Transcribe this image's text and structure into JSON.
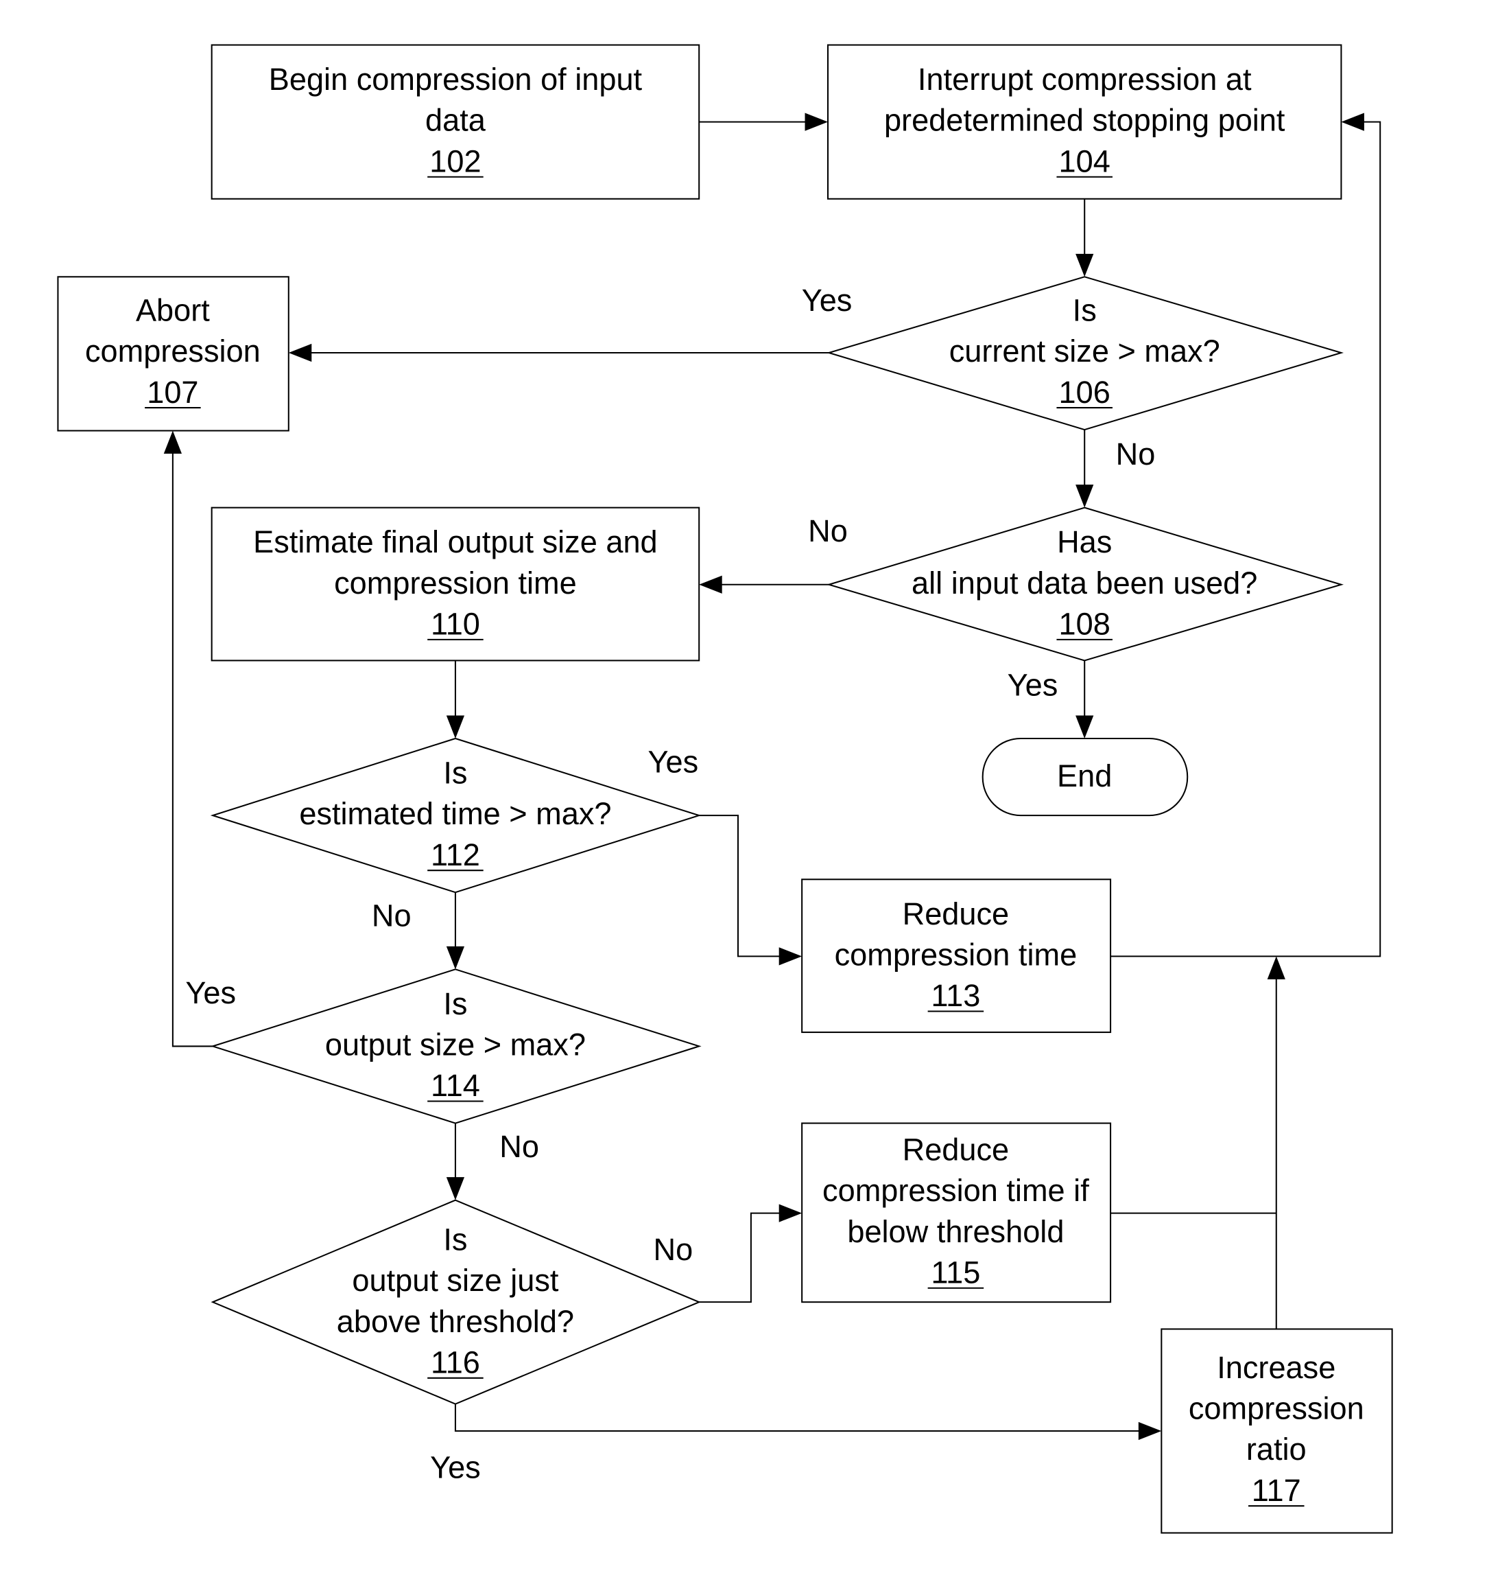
{
  "diagram": {
    "type": "flowchart",
    "nodes": {
      "n102": {
        "shape": "process",
        "lines": [
          "Begin compression of input",
          "data"
        ],
        "ref": "102"
      },
      "n104": {
        "shape": "process",
        "lines": [
          "Interrupt compression at",
          "predetermined stopping point"
        ],
        "ref": "104"
      },
      "n106": {
        "shape": "decision",
        "lines": [
          "Is",
          "current size > max?"
        ],
        "ref": "106"
      },
      "n107": {
        "shape": "process",
        "lines": [
          "Abort",
          "compression"
        ],
        "ref": "107"
      },
      "n108": {
        "shape": "decision",
        "lines": [
          "Has",
          "all input data been used?"
        ],
        "ref": "108"
      },
      "n110": {
        "shape": "process",
        "lines": [
          "Estimate final output size and",
          "compression time"
        ],
        "ref": "110"
      },
      "end": {
        "shape": "terminator",
        "lines": [
          "End"
        ]
      },
      "n112": {
        "shape": "decision",
        "lines": [
          "Is",
          "estimated time > max?"
        ],
        "ref": "112"
      },
      "n113": {
        "shape": "process",
        "lines": [
          "Reduce",
          "compression time"
        ],
        "ref": "113"
      },
      "n114": {
        "shape": "decision",
        "lines": [
          "Is",
          "output size > max?"
        ],
        "ref": "114"
      },
      "n115": {
        "shape": "process",
        "lines": [
          "Reduce",
          "compression time if",
          "below threshold"
        ],
        "ref": "115"
      },
      "n116": {
        "shape": "decision",
        "lines": [
          "Is",
          "output size just",
          "above threshold?"
        ],
        "ref": "116"
      },
      "n117": {
        "shape": "process",
        "lines": [
          "Increase",
          "compression",
          "ratio"
        ],
        "ref": "117"
      }
    },
    "edge_labels": {
      "e106_yes": "Yes",
      "e106_no": "No",
      "e108_no": "No",
      "e108_yes": "Yes",
      "e112_yes": "Yes",
      "e112_no": "No",
      "e114_yes": "Yes",
      "e114_no": "No",
      "e116_no": "No",
      "e116_yes": "Yes"
    },
    "edges": [
      {
        "from": "102",
        "to": "104"
      },
      {
        "from": "104",
        "to": "106"
      },
      {
        "from": "106",
        "to": "107",
        "label": "Yes"
      },
      {
        "from": "106",
        "to": "108",
        "label": "No"
      },
      {
        "from": "108",
        "to": "110",
        "label": "No"
      },
      {
        "from": "108",
        "to": "End",
        "label": "Yes"
      },
      {
        "from": "110",
        "to": "112"
      },
      {
        "from": "112",
        "to": "113",
        "label": "Yes"
      },
      {
        "from": "112",
        "to": "114",
        "label": "No"
      },
      {
        "from": "114",
        "to": "107",
        "label": "Yes"
      },
      {
        "from": "114",
        "to": "116",
        "label": "No"
      },
      {
        "from": "116",
        "to": "115",
        "label": "No"
      },
      {
        "from": "116",
        "to": "117",
        "label": "Yes"
      },
      {
        "from": "113",
        "to": "104"
      },
      {
        "from": "115",
        "to": "104"
      },
      {
        "from": "117",
        "to": "104"
      }
    ]
  }
}
